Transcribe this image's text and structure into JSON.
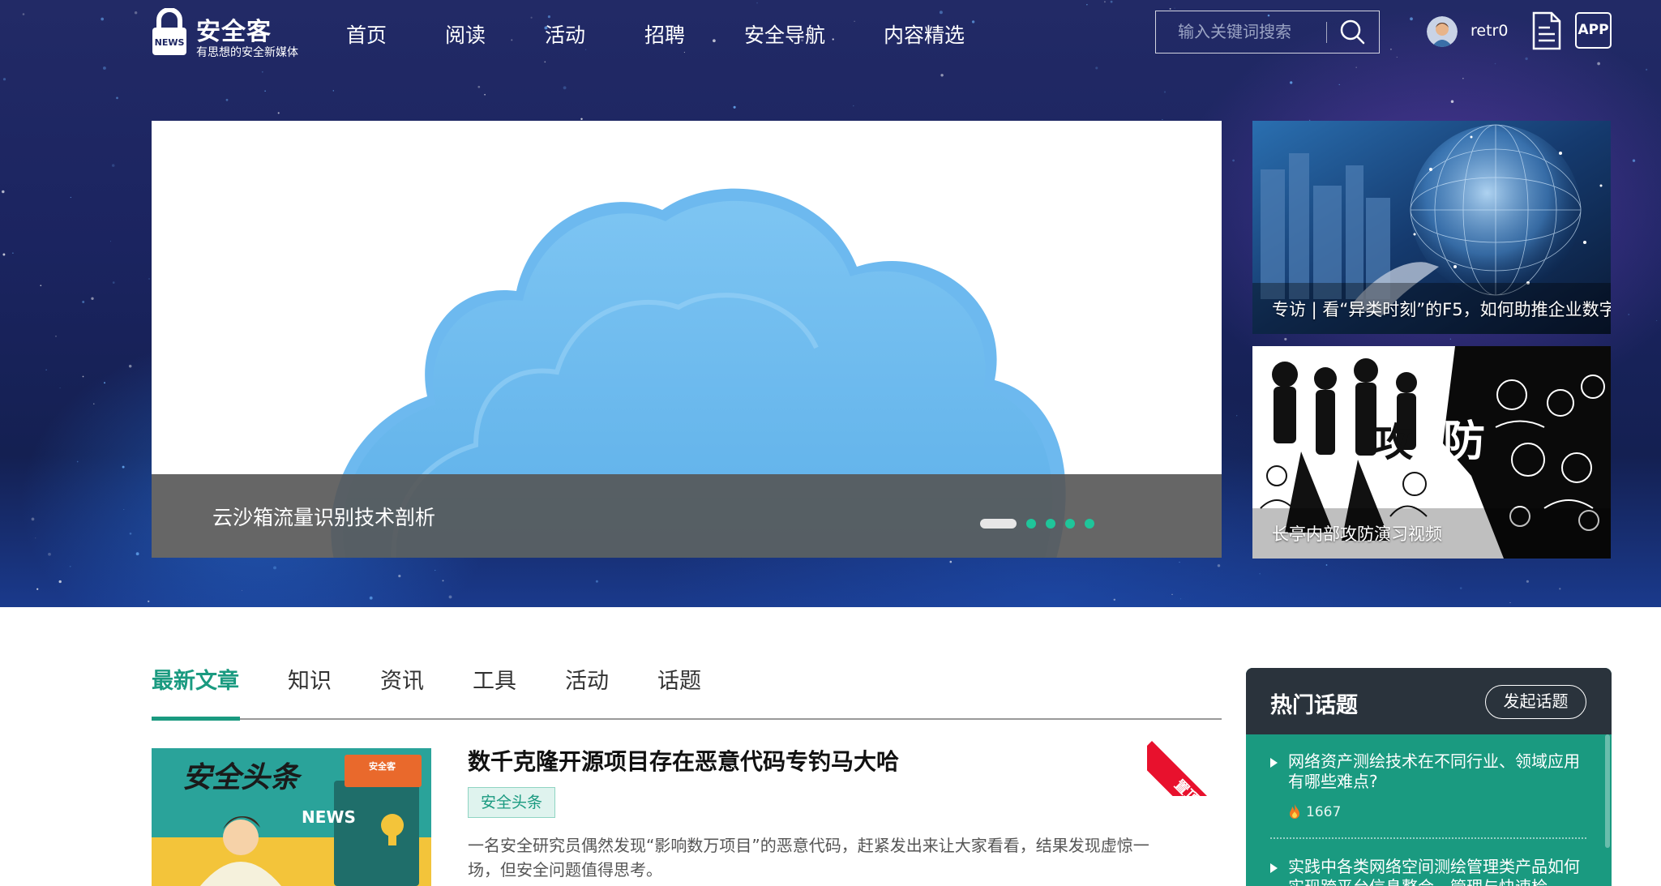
{
  "header": {
    "logo_title": "安全客",
    "logo_sub": "有思想的安全新媒体",
    "logo_badge": "NEWS",
    "nav": [
      "首页",
      "阅读",
      "活动",
      "招聘",
      "安全导航",
      "内容精选"
    ],
    "search_placeholder": "输入关键词搜索",
    "username": "retr0",
    "app_label": "APP"
  },
  "carousel": {
    "caption": "云沙箱流量识别技术剖析",
    "slide_count": 5,
    "active_index": 0
  },
  "side_cards": [
    {
      "caption": "专访 | 看“异类时刻”的F5，如何助推企业数字"
    },
    {
      "caption": "长亭内部攻防演习视频"
    }
  ],
  "tabs": [
    "最新文章",
    "知识",
    "资讯",
    "工具",
    "活动",
    "话题"
  ],
  "article": {
    "title": "数千克隆开源项目存在恶意代码专钓马大哈",
    "tag": "安全头条",
    "description": "一名安全研究员偶然发现“影响数万项目”的恶意代码，赶紧发出来让大家看看，结果发现虚惊一场，但安全问题值得思考。",
    "pin_label": "置顶",
    "thumb_title": "安全头条",
    "thumb_news": "NEWS",
    "thumb_badge": "安全客"
  },
  "hot_topics": {
    "title": "热门话题",
    "button": "发起话题",
    "items": [
      {
        "question": "网络资产测绘技术在不同行业、领域应用有哪些难点?",
        "count": "1667"
      },
      {
        "question": "实践中各类网络空间测绘管理类产品如何实现跨平台信息整合、管理与快速检",
        "count": ""
      }
    ]
  },
  "colors": {
    "accent": "#1a9a80",
    "hot_header": "#2a333c",
    "pin": "#e8112d",
    "carousel_dot": "#1fc59a"
  }
}
